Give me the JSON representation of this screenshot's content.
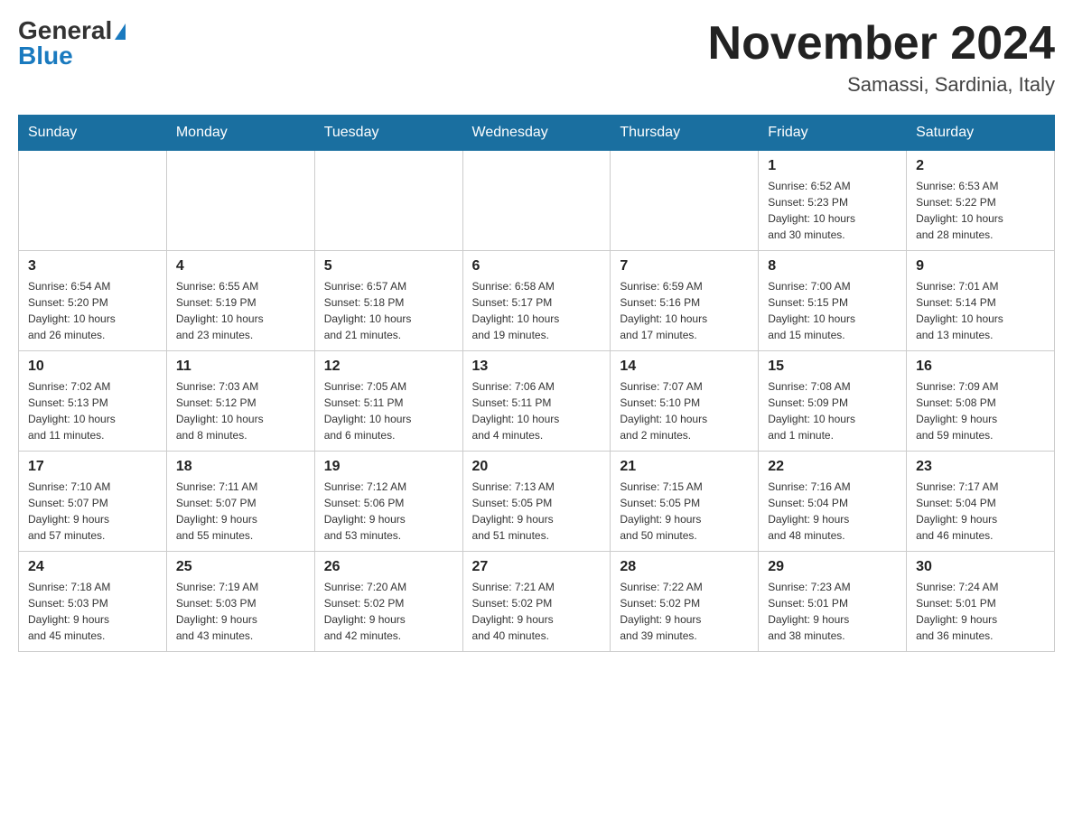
{
  "header": {
    "logo_general": "General",
    "logo_blue": "Blue",
    "month_title": "November 2024",
    "location": "Samassi, Sardinia, Italy"
  },
  "weekdays": [
    "Sunday",
    "Monday",
    "Tuesday",
    "Wednesday",
    "Thursday",
    "Friday",
    "Saturday"
  ],
  "weeks": [
    [
      {
        "day": "",
        "info": ""
      },
      {
        "day": "",
        "info": ""
      },
      {
        "day": "",
        "info": ""
      },
      {
        "day": "",
        "info": ""
      },
      {
        "day": "",
        "info": ""
      },
      {
        "day": "1",
        "info": "Sunrise: 6:52 AM\nSunset: 5:23 PM\nDaylight: 10 hours\nand 30 minutes."
      },
      {
        "day": "2",
        "info": "Sunrise: 6:53 AM\nSunset: 5:22 PM\nDaylight: 10 hours\nand 28 minutes."
      }
    ],
    [
      {
        "day": "3",
        "info": "Sunrise: 6:54 AM\nSunset: 5:20 PM\nDaylight: 10 hours\nand 26 minutes."
      },
      {
        "day": "4",
        "info": "Sunrise: 6:55 AM\nSunset: 5:19 PM\nDaylight: 10 hours\nand 23 minutes."
      },
      {
        "day": "5",
        "info": "Sunrise: 6:57 AM\nSunset: 5:18 PM\nDaylight: 10 hours\nand 21 minutes."
      },
      {
        "day": "6",
        "info": "Sunrise: 6:58 AM\nSunset: 5:17 PM\nDaylight: 10 hours\nand 19 minutes."
      },
      {
        "day": "7",
        "info": "Sunrise: 6:59 AM\nSunset: 5:16 PM\nDaylight: 10 hours\nand 17 minutes."
      },
      {
        "day": "8",
        "info": "Sunrise: 7:00 AM\nSunset: 5:15 PM\nDaylight: 10 hours\nand 15 minutes."
      },
      {
        "day": "9",
        "info": "Sunrise: 7:01 AM\nSunset: 5:14 PM\nDaylight: 10 hours\nand 13 minutes."
      }
    ],
    [
      {
        "day": "10",
        "info": "Sunrise: 7:02 AM\nSunset: 5:13 PM\nDaylight: 10 hours\nand 11 minutes."
      },
      {
        "day": "11",
        "info": "Sunrise: 7:03 AM\nSunset: 5:12 PM\nDaylight: 10 hours\nand 8 minutes."
      },
      {
        "day": "12",
        "info": "Sunrise: 7:05 AM\nSunset: 5:11 PM\nDaylight: 10 hours\nand 6 minutes."
      },
      {
        "day": "13",
        "info": "Sunrise: 7:06 AM\nSunset: 5:11 PM\nDaylight: 10 hours\nand 4 minutes."
      },
      {
        "day": "14",
        "info": "Sunrise: 7:07 AM\nSunset: 5:10 PM\nDaylight: 10 hours\nand 2 minutes."
      },
      {
        "day": "15",
        "info": "Sunrise: 7:08 AM\nSunset: 5:09 PM\nDaylight: 10 hours\nand 1 minute."
      },
      {
        "day": "16",
        "info": "Sunrise: 7:09 AM\nSunset: 5:08 PM\nDaylight: 9 hours\nand 59 minutes."
      }
    ],
    [
      {
        "day": "17",
        "info": "Sunrise: 7:10 AM\nSunset: 5:07 PM\nDaylight: 9 hours\nand 57 minutes."
      },
      {
        "day": "18",
        "info": "Sunrise: 7:11 AM\nSunset: 5:07 PM\nDaylight: 9 hours\nand 55 minutes."
      },
      {
        "day": "19",
        "info": "Sunrise: 7:12 AM\nSunset: 5:06 PM\nDaylight: 9 hours\nand 53 minutes."
      },
      {
        "day": "20",
        "info": "Sunrise: 7:13 AM\nSunset: 5:05 PM\nDaylight: 9 hours\nand 51 minutes."
      },
      {
        "day": "21",
        "info": "Sunrise: 7:15 AM\nSunset: 5:05 PM\nDaylight: 9 hours\nand 50 minutes."
      },
      {
        "day": "22",
        "info": "Sunrise: 7:16 AM\nSunset: 5:04 PM\nDaylight: 9 hours\nand 48 minutes."
      },
      {
        "day": "23",
        "info": "Sunrise: 7:17 AM\nSunset: 5:04 PM\nDaylight: 9 hours\nand 46 minutes."
      }
    ],
    [
      {
        "day": "24",
        "info": "Sunrise: 7:18 AM\nSunset: 5:03 PM\nDaylight: 9 hours\nand 45 minutes."
      },
      {
        "day": "25",
        "info": "Sunrise: 7:19 AM\nSunset: 5:03 PM\nDaylight: 9 hours\nand 43 minutes."
      },
      {
        "day": "26",
        "info": "Sunrise: 7:20 AM\nSunset: 5:02 PM\nDaylight: 9 hours\nand 42 minutes."
      },
      {
        "day": "27",
        "info": "Sunrise: 7:21 AM\nSunset: 5:02 PM\nDaylight: 9 hours\nand 40 minutes."
      },
      {
        "day": "28",
        "info": "Sunrise: 7:22 AM\nSunset: 5:02 PM\nDaylight: 9 hours\nand 39 minutes."
      },
      {
        "day": "29",
        "info": "Sunrise: 7:23 AM\nSunset: 5:01 PM\nDaylight: 9 hours\nand 38 minutes."
      },
      {
        "day": "30",
        "info": "Sunrise: 7:24 AM\nSunset: 5:01 PM\nDaylight: 9 hours\nand 36 minutes."
      }
    ]
  ]
}
